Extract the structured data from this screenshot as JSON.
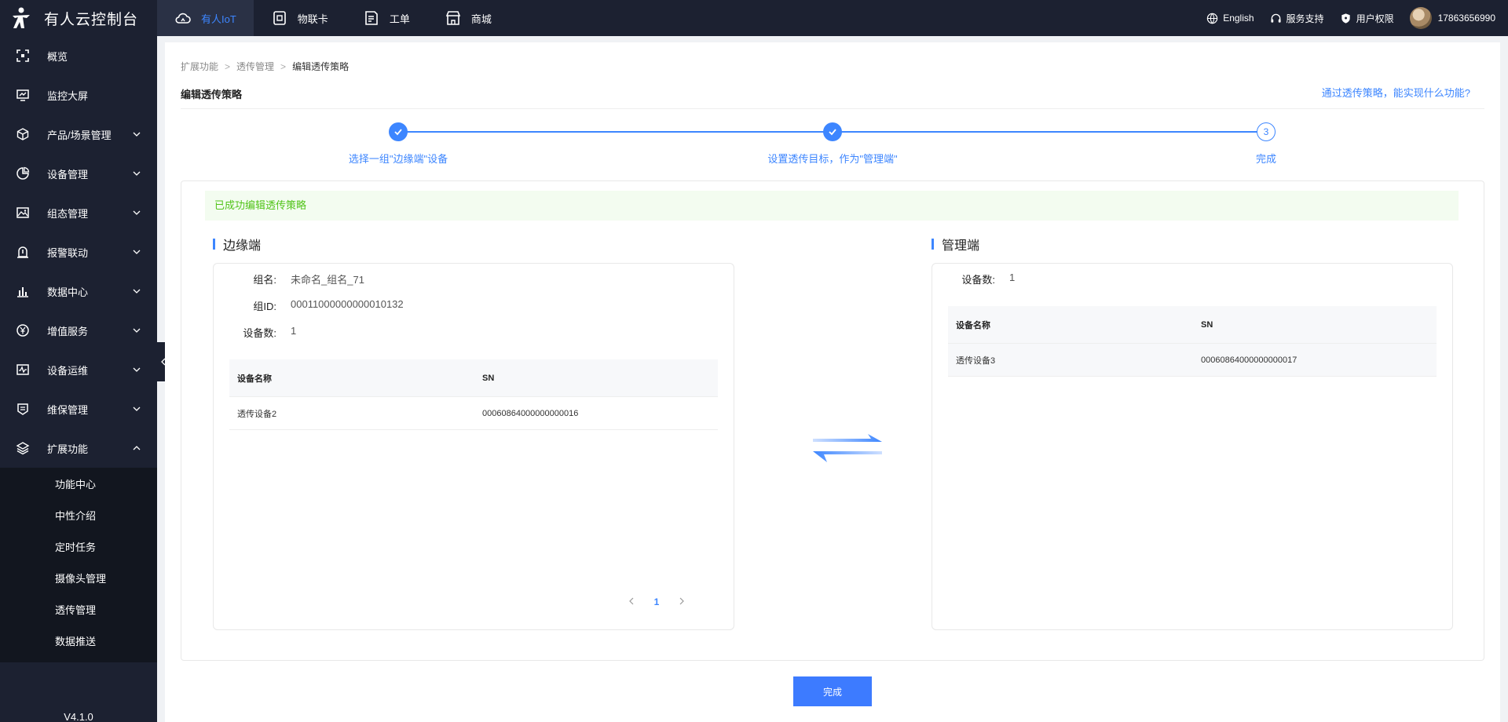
{
  "brand": {
    "name": "有人云控制台"
  },
  "topnav": [
    {
      "label": "有人IoT",
      "icon": "cloud-icon",
      "active": true
    },
    {
      "label": "物联卡",
      "icon": "sim-card-icon",
      "active": false
    },
    {
      "label": "工单",
      "icon": "work-order-icon",
      "active": false
    },
    {
      "label": "商城",
      "icon": "shop-icon",
      "active": false
    }
  ],
  "topright": {
    "language": "English",
    "support": "服务支持",
    "permissions": "用户权限",
    "user": "17863656990"
  },
  "sidebar": {
    "items": [
      {
        "label": "概览",
        "icon": "overview-icon"
      },
      {
        "label": "监控大屏",
        "icon": "monitor-screen-icon"
      },
      {
        "label": "产品/场景管理",
        "icon": "cube-icon"
      },
      {
        "label": "设备管理",
        "icon": "pie-icon"
      },
      {
        "label": "组态管理",
        "icon": "image-icon"
      },
      {
        "label": "报警联动",
        "icon": "alarm-icon"
      },
      {
        "label": "数据中心",
        "icon": "bar-chart-icon"
      },
      {
        "label": "增值服务",
        "icon": "yen-icon"
      },
      {
        "label": "设备运维",
        "icon": "ops-icon"
      },
      {
        "label": "维保管理",
        "icon": "maintenance-icon"
      },
      {
        "label": "扩展功能",
        "icon": "layers-icon"
      }
    ],
    "subitems": [
      "功能中心",
      "中性介绍",
      "定时任务",
      "摄像头管理",
      "透传管理",
      "数据推送"
    ],
    "version": "V4.1.0"
  },
  "breadcrumb": [
    "扩展功能",
    "透传管理",
    "编辑透传策略"
  ],
  "page_title": "编辑透传策略",
  "help_link": "通过透传策略，能实现什么功能?",
  "steps": [
    {
      "label": "选择一组\"边缘端\"设备",
      "status": "done"
    },
    {
      "label": "设置透传目标，作为\"管理端\"",
      "status": "done"
    },
    {
      "label": "完成",
      "status": "current",
      "number": "3"
    }
  ],
  "success_message": "已成功编辑透传策略",
  "edge": {
    "title": "边缘端",
    "group_name_label": "组名:",
    "group_name": "未命名_组名_71",
    "group_id_label": "组ID:",
    "group_id": "00011000000000010132",
    "device_count_label": "设备数:",
    "device_count": "1",
    "columns": [
      "设备名称",
      "SN"
    ],
    "rows": [
      {
        "name": "透传设备2",
        "sn": "00060864000000000016"
      }
    ],
    "page": "1"
  },
  "manager": {
    "title": "管理端",
    "device_count_label": "设备数:",
    "device_count": "1",
    "columns": [
      "设备名称",
      "SN"
    ],
    "rows": [
      {
        "name": "透传设备3",
        "sn": "00060864000000000017"
      }
    ]
  },
  "finish_button": "完成",
  "colors": {
    "accent": "#3d86ff",
    "success": "#52c41a",
    "sidebar_bg": "#1c2131"
  }
}
